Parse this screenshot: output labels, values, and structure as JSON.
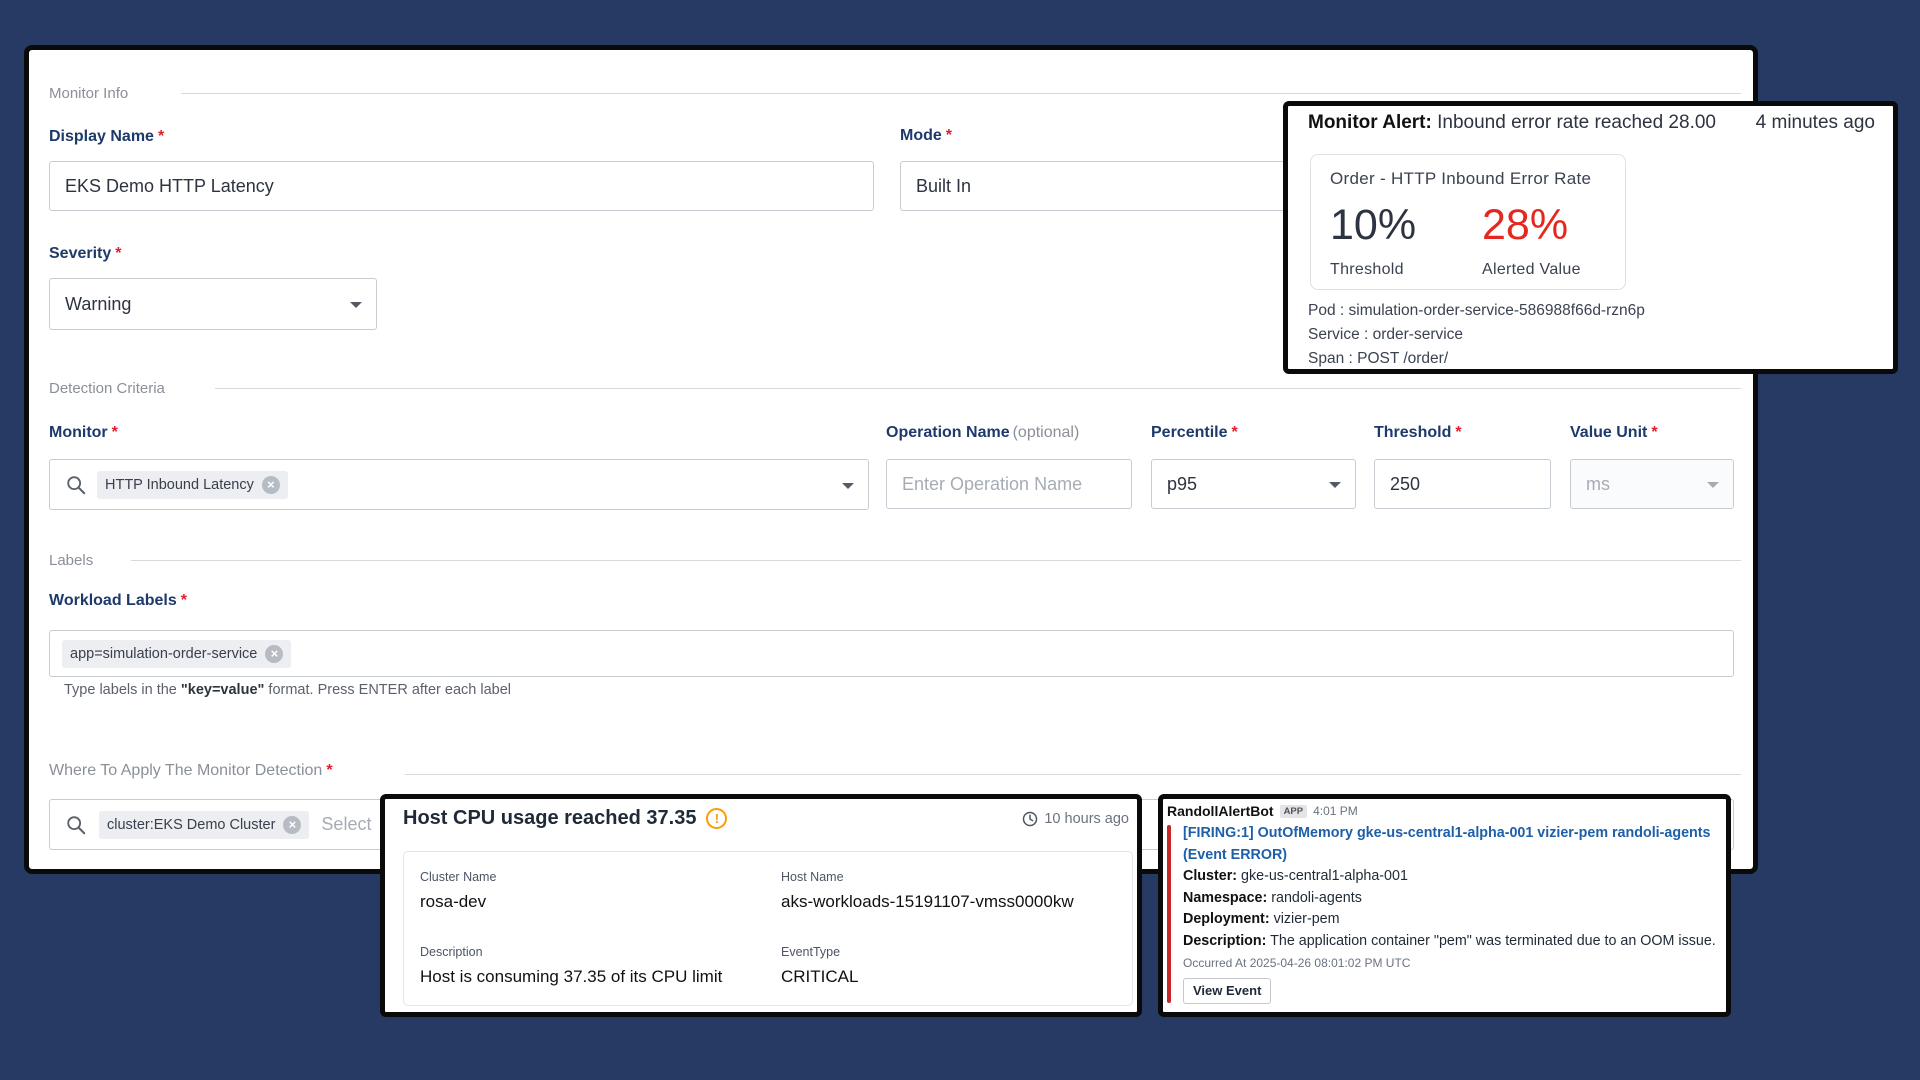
{
  "form": {
    "monitor_info": {
      "heading": "Monitor Info"
    },
    "display_name": {
      "label": "Display Name",
      "value": "EKS Demo HTTP Latency"
    },
    "mode": {
      "label": "Mode",
      "value": "Built In"
    },
    "severity": {
      "label": "Severity",
      "value": "Warning"
    },
    "detection_criteria": {
      "heading": "Detection Criteria"
    },
    "monitor": {
      "label": "Monitor",
      "chip": "HTTP Inbound Latency"
    },
    "operation_name": {
      "label": "Operation Name",
      "optional": "(optional)",
      "placeholder": "Enter Operation Name"
    },
    "percentile": {
      "label": "Percentile",
      "value": "p95"
    },
    "threshold": {
      "label": "Threshold",
      "value": "250"
    },
    "value_unit": {
      "label": "Value Unit",
      "value": "ms"
    },
    "labels": {
      "heading": "Labels"
    },
    "workload_labels": {
      "label": "Workload Labels",
      "chip": "app=simulation-order-service",
      "hint_pre": "Type labels in the",
      "hint_key": "\"key=value\"",
      "hint_post": "format. Press ENTER after each label"
    },
    "where_to_apply": {
      "heading": "Where To Apply The Monitor Detection",
      "chip": "cluster:EKS Demo Cluster",
      "placeholder": "Select"
    },
    "required_mark": "*"
  },
  "alert": {
    "title_bold": "Monitor Alert:",
    "title_rest": "Inbound error rate reached 28.00",
    "time": "4 minutes ago",
    "metric_title": "Order - HTTP Inbound Error Rate",
    "threshold_value": "10%",
    "threshold_label": "Threshold",
    "alerted_value": "28%",
    "alerted_label": "Alerted Value",
    "pod": "Pod : simulation-order-service-586988f66d-rzn6p",
    "service": "Service : order-service",
    "span": "Span : POST /order/",
    "colors": {
      "alerted": "#e5281f"
    }
  },
  "cpu": {
    "title": "Host CPU usage reached 37.35",
    "time": "10 hours ago",
    "cluster_label": "Cluster Name",
    "cluster_value": "rosa-dev",
    "host_label": "Host Name",
    "host_value": "aks-workloads-15191107-vmss0000kw",
    "desc_label": "Description",
    "desc_value": "Host is consuming 37.35 of its CPU limit",
    "event_label": "EventType",
    "event_value": "CRITICAL"
  },
  "slack": {
    "bot": "RandollAlertBot",
    "app_tag": "APP",
    "time": "4:01 PM",
    "link": "[FIRING:1] OutOfMemory gke-us-central1-alpha-001 vizier-pem randoli-agents (Event ERROR)",
    "cluster_k": "Cluster:",
    "cluster_v": "gke-us-central1-alpha-001",
    "namespace_k": "Namespace:",
    "namespace_v": "randoli-agents",
    "deployment_k": "Deployment:",
    "deployment_v": "vizier-pem",
    "description_k": "Description:",
    "description_v": "The application container \"pem\" was terminated due to an OOM issue.",
    "occurred": "Occurred At 2025-04-26 08:01:02 PM UTC",
    "button": "View Event"
  }
}
